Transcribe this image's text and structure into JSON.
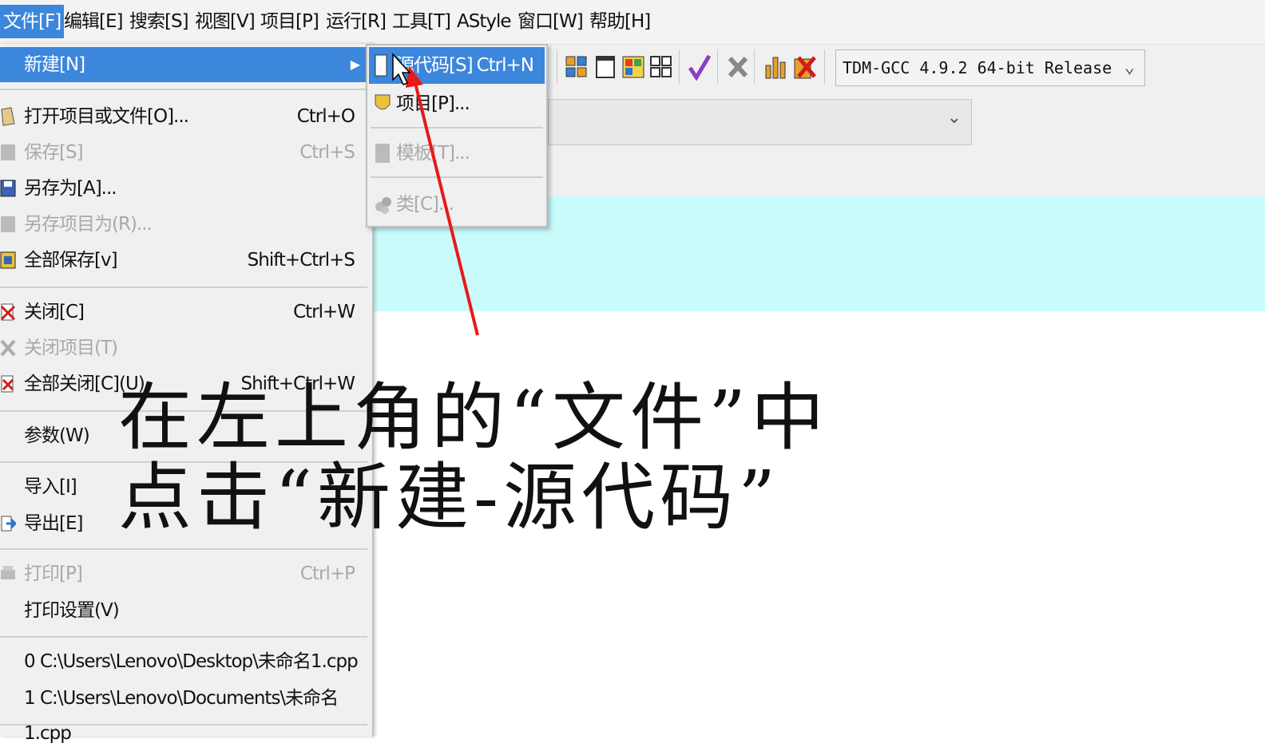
{
  "menubar": {
    "items": [
      "文件[F]",
      "编辑[E]",
      "搜索[S]",
      "视图[V]",
      "项目[P]",
      "运行[R]",
      "工具[T]",
      "AStyle",
      "窗口[W]",
      "帮助[H]"
    ]
  },
  "toolbar": {
    "compiler": "TDM-GCC 4.9.2 64-bit Release"
  },
  "file_menu": {
    "new": "新建[N]",
    "open": {
      "label": "打开项目或文件[O]...",
      "shortcut": "Ctrl+O"
    },
    "save": {
      "label": "保存[S]",
      "shortcut": "Ctrl+S"
    },
    "save_as": {
      "label": "另存为[A]..."
    },
    "save_project_as": {
      "label": "另存项目为(R)..."
    },
    "save_all": {
      "label": "全部保存[v]",
      "shortcut": "Shift+Ctrl+S"
    },
    "close": {
      "label": "关闭[C]",
      "shortcut": "Ctrl+W"
    },
    "close_project": {
      "label": "关闭项目(T)"
    },
    "close_all": {
      "label": "全部关闭[C](U)",
      "shortcut": "Shift+Ctrl+W"
    },
    "params": {
      "label": "参数(W)"
    },
    "import": {
      "label": "导入[I]"
    },
    "export": {
      "label": "导出[E]"
    },
    "print": {
      "label": "打印[P]",
      "shortcut": "Ctrl+P"
    },
    "print_setup": {
      "label": "打印设置(V)"
    },
    "recent": [
      "0 C:\\Users\\Lenovo\\Desktop\\未命名1.cpp",
      "1 C:\\Users\\Lenovo\\Documents\\未命名1.cpp"
    ]
  },
  "new_submenu": {
    "source": {
      "label": "源代码[S]",
      "shortcut": "Ctrl+N"
    },
    "project": {
      "label": "项目[P]..."
    },
    "template": {
      "label": "模板[T]..."
    },
    "class": {
      "label": "类[C]..."
    }
  },
  "annotation": {
    "line1": "在左上角的“文件”中",
    "line2": "点击“新建-源代码”"
  },
  "colors": {
    "highlight": "#3c86dc",
    "arrow": "#e8191a",
    "editor_strip": "#c9fbfb"
  }
}
